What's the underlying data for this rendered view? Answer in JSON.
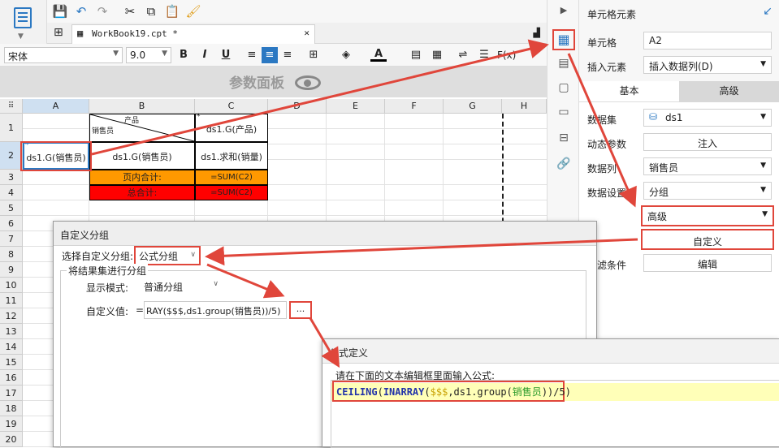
{
  "app": {
    "app_button": "app-menu"
  },
  "tab": {
    "title": "WorkBook19.cpt *",
    "close": "✕"
  },
  "format": {
    "font": "宋体",
    "size": "9.0"
  },
  "param_panel": {
    "title": "参数面板"
  },
  "grid": {
    "columns": [
      "A",
      "B",
      "C",
      "D",
      "E",
      "F",
      "G",
      "H"
    ],
    "rows": [
      "1",
      "2",
      "3",
      "4",
      "5",
      "6",
      "7",
      "8",
      "9",
      "10",
      "11",
      "12",
      "13",
      "14",
      "15",
      "16",
      "17",
      "18",
      "19",
      "20"
    ],
    "b1_top": "产品",
    "b1_bottom": "销售员",
    "c1": "ds1.G(产品)",
    "a2": "ds1.G(销售员)",
    "b2": "ds1.G(销售员)",
    "c2": "ds1.求和(销量)",
    "b3": "页内合计:",
    "c3": "=SUM(C2)",
    "b4": "总合计:",
    "c4": "=SUM(C2)",
    "corner_mark": "*"
  },
  "right_panel": {
    "title": "单元格元素",
    "cell_label": "单元格",
    "cell_value": "A2",
    "insert_label": "插入元素",
    "insert_value": "插入数据列(D)",
    "tab_basic": "基本",
    "tab_advanced": "高级",
    "dataset_label": "数据集",
    "dataset_value": "ds1",
    "dynamic_label": "动态参数",
    "inject_button": "注入",
    "column_label": "数据列",
    "column_value": "销售员",
    "setting_label": "数据设置",
    "setting_value": "分组",
    "group_value": "高级",
    "custom_button": "自定义",
    "filter_label": "过滤条件",
    "edit_button": "编辑"
  },
  "dialog_group": {
    "title": "自定义分组",
    "select_label": "选择自定义分组:",
    "select_value": "公式分组",
    "section_label": "将结果集进行分组",
    "display_label": "显示模式:",
    "display_value": "普通分组",
    "custom_label": "自定义值:",
    "custom_prefix": "=",
    "custom_value": "RAY($$$,ds1.group(销售员))/5)",
    "ellipsis": "..."
  },
  "dialog_formula": {
    "title": "公式定义",
    "prompt": "请在下面的文本编辑框里面输入公式:",
    "formula_parts": {
      "fn1": "CEILING",
      "p1": "(",
      "fn2": "INARRAY",
      "p2": "(",
      "var": "$$$",
      "mid": ",ds1.group(",
      "str": "销售员",
      "tail": "))/5)"
    }
  },
  "colors": {
    "accent": "#2b78c2",
    "highlight": "#e0463b",
    "orange": "#ff9900",
    "redfill": "#ff0000"
  }
}
